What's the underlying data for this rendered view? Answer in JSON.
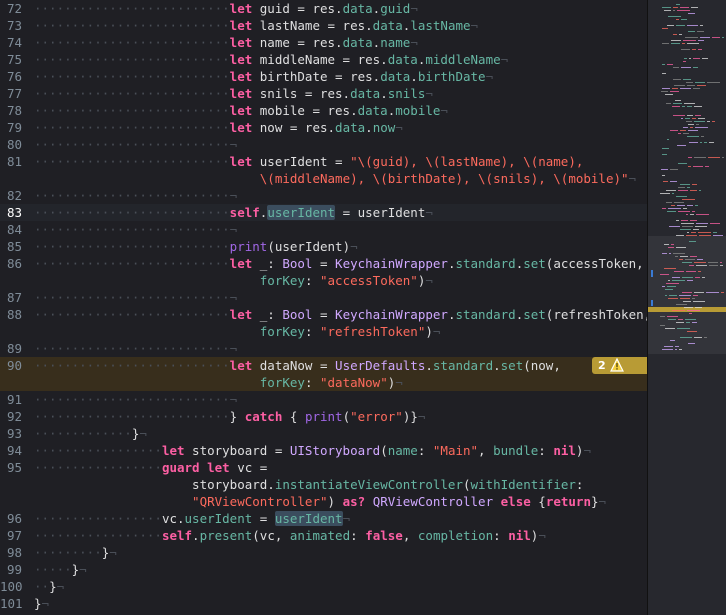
{
  "gutter": {
    "line_numbers": [
      "72",
      "73",
      "74",
      "75",
      "76",
      "77",
      "78",
      "79",
      "80",
      "81",
      "82",
      "83",
      "84",
      "85",
      "86",
      "87",
      "88",
      "89",
      "90",
      "91",
      "92",
      "93",
      "94",
      "95",
      "96",
      "97",
      "98",
      "99",
      "100",
      "101"
    ],
    "current_line": "83"
  },
  "code": {
    "l72": {
      "kw": "let",
      "a": " guid = res.",
      "b": "data",
      ".": ".",
      "c": "guid"
    },
    "l73": {
      "kw": "let",
      "a": " lastName = res.",
      "b": "data",
      "c": "lastName"
    },
    "l74": {
      "kw": "let",
      "a": " name = res.",
      "b": "data",
      "c": "name"
    },
    "l75": {
      "kw": "let",
      "a": " middleName = res.",
      "b": "data",
      "c": "middleName"
    },
    "l76": {
      "kw": "let",
      "a": " birthDate = res.",
      "b": "data",
      "c": "birthDate"
    },
    "l77": {
      "kw": "let",
      "a": " snils = res.",
      "b": "data",
      "c": "snils"
    },
    "l78": {
      "kw": "let",
      "a": " mobile = res.",
      "b": "data",
      "c": "mobile"
    },
    "l79": {
      "kw": "let",
      "a": " now = res.",
      "b": "data",
      "c": "now"
    },
    "l81a": {
      "kw": "let",
      "a": " userIdent = ",
      "s": "\"\\(guid), \\(lastName), \\(name),"
    },
    "l81b": {
      "s": "\\(middleName), \\(birthDate), \\(snils), \\(mobile)\""
    },
    "l83": {
      "kw": "self",
      "a": ".",
      "sel": "userIdent",
      "b": " = userIdent"
    },
    "l85": {
      "fn": "print",
      "a": "(userIdent)"
    },
    "l86a": {
      "kw": "let",
      "a": " _: ",
      "ty": "Bool",
      "b": " = ",
      "ty2": "KeychainWrapper",
      "c": ".",
      "pr": "standard",
      "d": ".",
      "pr2": "set",
      "e": "(accessToken,"
    },
    "l86b": {
      "pr": "forKey",
      "a": ": ",
      "s": "\"accessToken\"",
      "b": ")"
    },
    "l88a": {
      "kw": "let",
      "a": " _: ",
      "ty": "Bool",
      "b": " = ",
      "ty2": "KeychainWrapper",
      "c": ".",
      "pr": "standard",
      "d": ".",
      "pr2": "set",
      "e": "(refreshToken,"
    },
    "l88b": {
      "pr": "forKey",
      "a": ": ",
      "s": "\"refreshToken\"",
      "b": ")"
    },
    "l90a": {
      "kw": "let",
      "a": " dataNow = ",
      "ty": "UserDefaults",
      "c": ".",
      "pr": "standard",
      "d": ".",
      "pr2": "set",
      "e": "(now,"
    },
    "l90b": {
      "pr": "forKey",
      "a": ": ",
      "s": "\"dataNow\"",
      "b": ")"
    },
    "l92": {
      "a": "} ",
      "kw": "catch",
      "b": " { ",
      "fn": "print",
      "c": "(",
      "s": "\"error\"",
      "d": ")}"
    },
    "l93": {
      "a": "}"
    },
    "l94": {
      "kw": "let",
      "a": " storyboard = ",
      "ty": "UIStoryboard",
      "b": "(",
      "pr": "name",
      "c": ": ",
      "s": "\"Main\"",
      "d": ", ",
      "pr2": "bundle",
      "e": ": ",
      "kw2": "nil",
      "f": ")"
    },
    "l95a": {
      "kw": "guard",
      "a": " ",
      "kw2": "let",
      "b": " vc ="
    },
    "l95b": {
      "a": "storyboard.",
      "pr": "instantiateViewController",
      "b": "(",
      "pr2": "withIdentifier",
      "c": ":"
    },
    "l95c": {
      "s": "\"QRViewController\"",
      "a": ") ",
      "kw": "as?",
      "b": " ",
      "ty": "QRViewController",
      "c": " ",
      "kw2": "else",
      "d": " {",
      "kw3": "return",
      "e": "}"
    },
    "l96": {
      "a": "vc.",
      "pr": "userIdent",
      "b": " = ",
      "sel": "userIdent"
    },
    "l97": {
      "kw": "self",
      "a": ".",
      "pr": "present",
      "b": "(vc, ",
      "pr2": "animated",
      "c": ": ",
      "kw2": "false",
      "d": ", ",
      "pr3": "completion",
      "e": ": ",
      "kw3": "nil",
      "f": ")"
    },
    "l98": {
      "a": "}"
    },
    "l99": {
      "a": "}"
    },
    "l100": {
      "a": "}"
    },
    "l101": {
      "a": "}"
    }
  },
  "warning": {
    "count": "2",
    "icon": "warning-triangle-icon",
    "color": "#b89b35"
  },
  "colors": {
    "keyword": "#fc5fa3",
    "string": "#fc6a5d",
    "type": "#d0a8ff",
    "property": "#67b7a4",
    "background": "#1f1f24"
  }
}
